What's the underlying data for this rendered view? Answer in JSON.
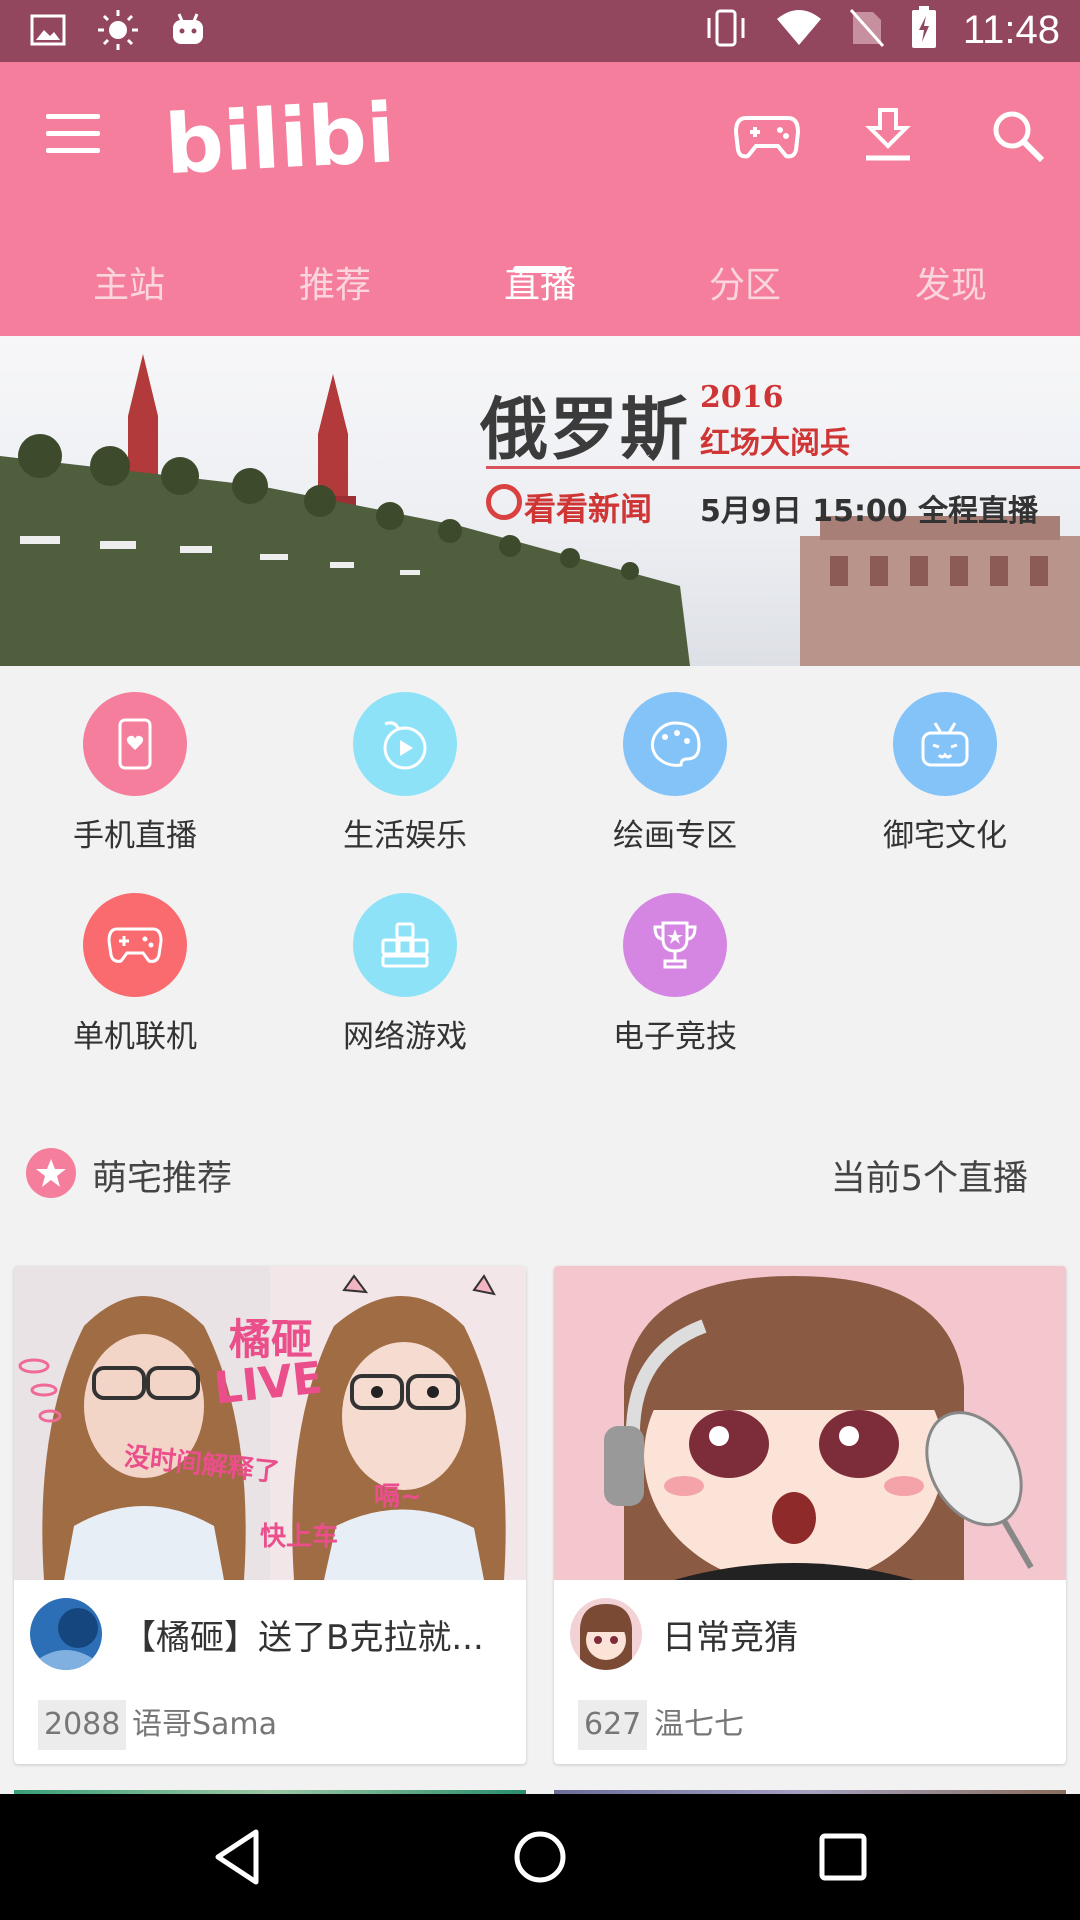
{
  "status_bar": {
    "time": "11:48",
    "left_icons": [
      "image-icon",
      "brightness-icon",
      "android-icon"
    ],
    "right_icons": [
      "vibrate-icon",
      "wifi-icon",
      "no-sim-icon",
      "battery-charging-icon"
    ]
  },
  "app_bar": {
    "logo_text": "bilibili",
    "actions": [
      "game-controller-icon",
      "download-icon",
      "search-icon"
    ],
    "brand_color": "#f47e9b"
  },
  "tabs": [
    {
      "label": "主站",
      "active": false
    },
    {
      "label": "推荐",
      "active": false
    },
    {
      "label": "直播",
      "active": true
    },
    {
      "label": "分区",
      "active": false
    },
    {
      "label": "发现",
      "active": false
    }
  ],
  "banner": {
    "title": "俄罗斯",
    "year": "2016",
    "subtitle": "红场大阅兵",
    "brand": "看看新闻",
    "schedule": "5月9日 15:00 全程直播"
  },
  "categories": [
    {
      "label": "手机直播",
      "icon": "phone-live-icon",
      "color": "#f47e9b"
    },
    {
      "label": "生活娱乐",
      "icon": "lifestyle-icon",
      "color": "#8ee2f8"
    },
    {
      "label": "绘画专区",
      "icon": "palette-icon",
      "color": "#84c3f8"
    },
    {
      "label": "御宅文化",
      "icon": "tv-mascot-icon",
      "color": "#84c3f8"
    },
    {
      "label": "单机联机",
      "icon": "gamepad-icon",
      "color": "#fa6b6f"
    },
    {
      "label": "网络游戏",
      "icon": "keyboard-keys-icon",
      "color": "#8ee2f8"
    },
    {
      "label": "电子竞技",
      "icon": "trophy-icon",
      "color": "#d586e3"
    }
  ],
  "section": {
    "title": "萌宅推荐",
    "count_label": "当前5个直播"
  },
  "streams": [
    {
      "title": "【橘砸】送了B克拉就...",
      "viewers": "2088",
      "owner": "语哥Sama",
      "thumb_texts": [
        "橘砸",
        "LIVE",
        "没时间解释了",
        "快上车",
        "嗝~"
      ]
    },
    {
      "title": "日常竞猜",
      "viewers": "627",
      "owner": "温七七",
      "thumb_texts": []
    }
  ],
  "nav_bar": [
    "back-icon",
    "home-icon",
    "recents-icon"
  ]
}
